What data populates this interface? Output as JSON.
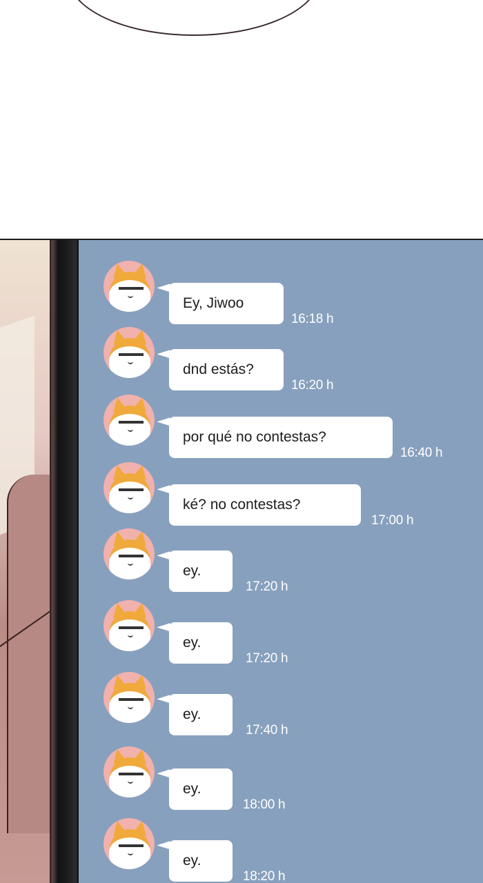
{
  "colors": {
    "chat_background": "#87a0be",
    "bubble": "#ffffff",
    "timestamp": "#ffffff",
    "avatar_background": "#f1b1ad"
  },
  "chat": {
    "avatar_icon": "cat-face-icon",
    "messages": [
      {
        "text": "Ey, Jiwoo",
        "time": "16:18 h"
      },
      {
        "text": "dnd estás?",
        "time": "16:20 h"
      },
      {
        "text": "por qué no contestas?",
        "time": "16:40 h"
      },
      {
        "text": "ké? no contestas?",
        "time": "17:00 h"
      },
      {
        "text": "ey.",
        "time": "17:20 h"
      },
      {
        "text": "ey.",
        "time": "17:20 h"
      },
      {
        "text": "ey.",
        "time": "17:40 h"
      },
      {
        "text": "ey.",
        "time": "18:00 h"
      },
      {
        "text": "ey.",
        "time": "18:20 h"
      }
    ]
  }
}
